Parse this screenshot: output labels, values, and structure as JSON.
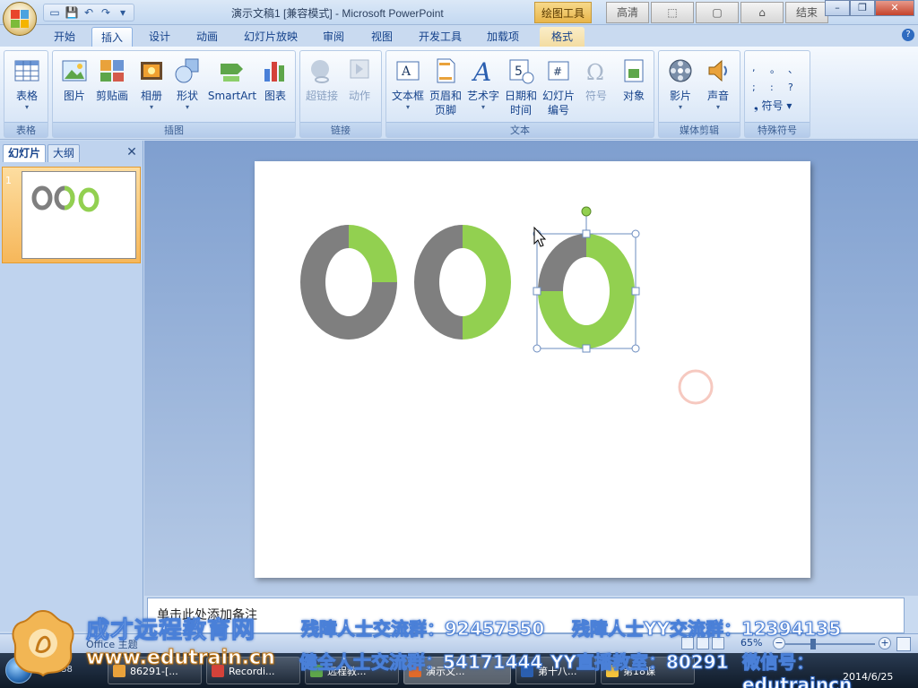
{
  "window": {
    "title": "演示文稿1 [兼容模式] - Microsoft PowerPoint",
    "context_tab_header": "绘图工具",
    "recorder_buttons": [
      "高清",
      "",
      "",
      "",
      "结束"
    ]
  },
  "tabs": [
    {
      "label": "开始"
    },
    {
      "label": "插入",
      "active": true
    },
    {
      "label": "设计"
    },
    {
      "label": "动画"
    },
    {
      "label": "幻灯片放映"
    },
    {
      "label": "审阅"
    },
    {
      "label": "视图"
    },
    {
      "label": "开发工具"
    },
    {
      "label": "加载项"
    },
    {
      "label": "格式"
    }
  ],
  "ribbon": {
    "groups": [
      {
        "name": "表格",
        "buttons": [
          {
            "label": "表格",
            "icon": "table-icon"
          }
        ]
      },
      {
        "name": "插图",
        "buttons": [
          {
            "label": "图片",
            "icon": "picture-icon"
          },
          {
            "label": "剪贴画",
            "icon": "clipart-icon"
          },
          {
            "label": "相册",
            "icon": "album-icon"
          },
          {
            "label": "形状",
            "icon": "shapes-icon"
          },
          {
            "label": "SmartArt",
            "icon": "smartart-icon"
          },
          {
            "label": "图表",
            "icon": "chart-icon"
          }
        ]
      },
      {
        "name": "链接",
        "buttons": [
          {
            "label": "超链接",
            "icon": "hyperlink-icon",
            "disabled": true
          },
          {
            "label": "动作",
            "icon": "action-icon",
            "disabled": true
          }
        ]
      },
      {
        "name": "文本",
        "buttons": [
          {
            "label": "文本框",
            "icon": "textbox-icon"
          },
          {
            "label": "页眉和",
            "label2": "页脚",
            "icon": "header-footer-icon"
          },
          {
            "label": "艺术字",
            "icon": "wordart-icon"
          },
          {
            "label": "日期和",
            "label2": "时间",
            "icon": "date-time-icon"
          },
          {
            "label": "幻灯片",
            "label2": "编号",
            "icon": "slide-number-icon"
          },
          {
            "label": "符号",
            "icon": "omega-icon",
            "disabled": true
          },
          {
            "label": "对象",
            "icon": "object-icon"
          }
        ]
      },
      {
        "name": "媒体剪辑",
        "buttons": [
          {
            "label": "影片",
            "icon": "film-icon"
          },
          {
            "label": "声音",
            "icon": "speaker-icon"
          }
        ]
      },
      {
        "name": "特殊符号",
        "buttons": [
          {
            "label": "符号",
            "icon": "special-symbol-icon"
          }
        ],
        "symbols": [
          ",",
          "。",
          "、",
          ";",
          ":",
          "?"
        ]
      }
    ]
  },
  "left_pane": {
    "tabs": [
      "幻灯片",
      "大纲"
    ],
    "slide_number": "1"
  },
  "slide": {
    "donut_colors": {
      "gray": "#7f7f7f",
      "green": "#92d050"
    },
    "donuts": [
      {
        "name": "donut-1",
        "green_fraction": 0.25
      },
      {
        "name": "donut-2",
        "green_fraction": 0.5
      },
      {
        "name": "donut-3",
        "green_fraction": 0.75,
        "selected": true
      }
    ]
  },
  "notes": {
    "placeholder": "单击此处添加备注"
  },
  "status": {
    "left_text": "Office 主题",
    "zoom": "65%"
  },
  "taskbar": {
    "time": "00:07:38",
    "items": [
      "86291-[...",
      "Recordi...",
      "远程教...",
      "演示文...",
      "第十八...",
      "第18课"
    ],
    "date": "2014/6/25"
  },
  "watermark": {
    "brand": "成才远程教育网",
    "url": "www.edutrain.cn",
    "line1a": "残障人士交流群：92457550",
    "line1b": "残障人士YY交流群：12394135",
    "line2a": "健全人士交流群：54171444",
    "line2b": "YY直播教室：80291",
    "line2c": "微信号：edutraincn"
  }
}
